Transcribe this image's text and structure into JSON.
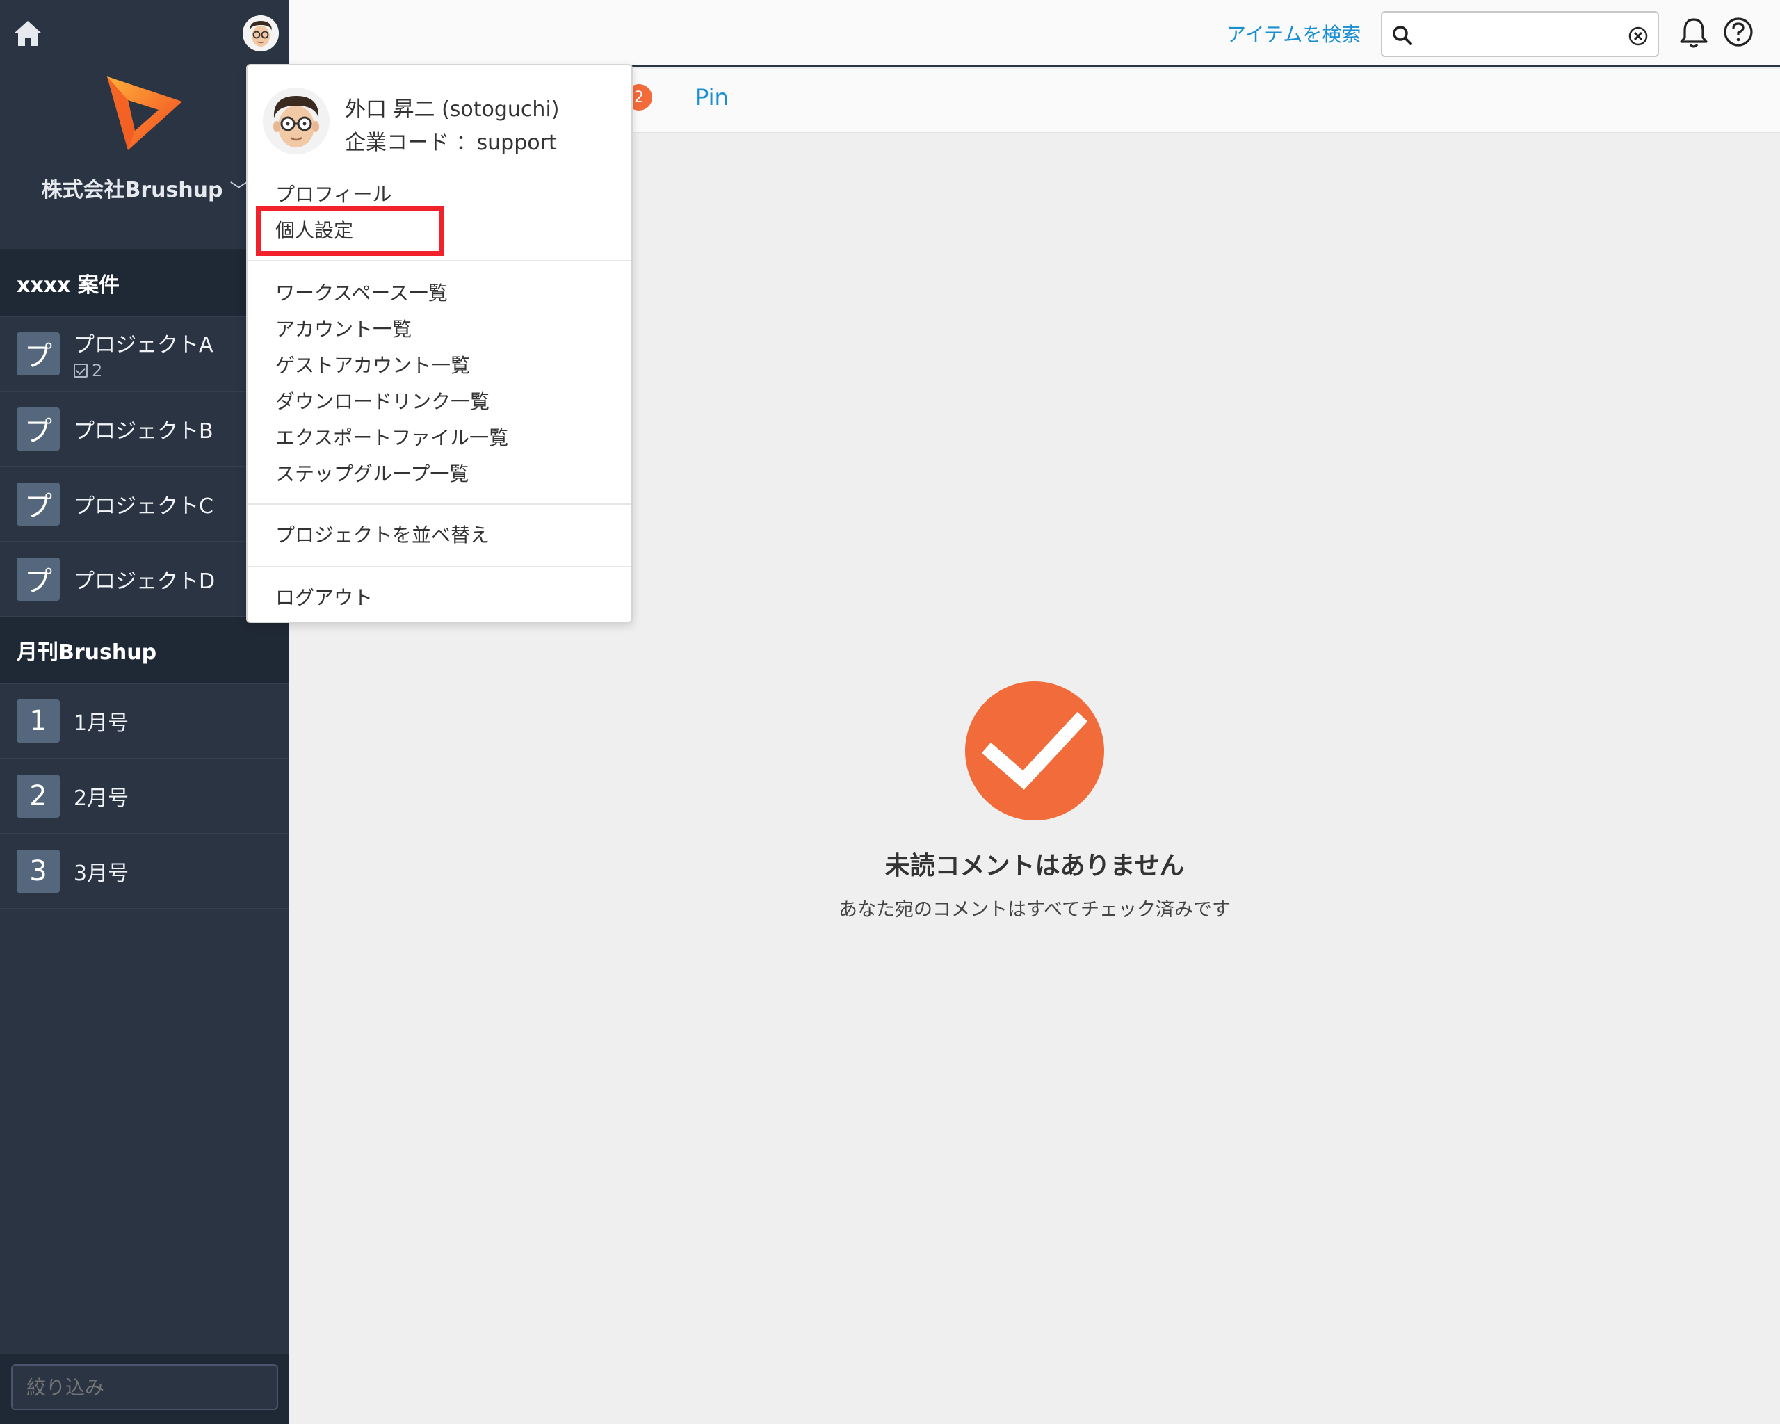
{
  "sidebar": {
    "company_name": "株式会社Brushup",
    "groups": [
      {
        "title": "xxxx 案件",
        "items": [
          {
            "icon_char": "プ",
            "label": "プロジェクトA",
            "sub": "2"
          },
          {
            "icon_char": "プ",
            "label": "プロジェクトB"
          },
          {
            "icon_char": "プ",
            "label": "プロジェクトC"
          },
          {
            "icon_char": "プ",
            "label": "プロジェクトD"
          }
        ]
      },
      {
        "title": "月刊Brushup",
        "items": [
          {
            "icon_char": "1",
            "label": "1月号"
          },
          {
            "icon_char": "2",
            "label": "2月号"
          },
          {
            "icon_char": "3",
            "label": "3月号"
          }
        ]
      }
    ],
    "filter_placeholder": "絞り込み"
  },
  "topbar": {
    "search_label": "アイテムを検索",
    "search_value": ""
  },
  "tabs": {
    "badge_count": "2",
    "pin_label": "Pin"
  },
  "empty_state": {
    "title": "未読コメントはありません",
    "subtitle": "あなた宛のコメントはすべてチェック済みです"
  },
  "user_menu": {
    "user_name": "外口 昇二 (sotoguchi)",
    "company_code": "企業コード ：support",
    "items_section1": [
      "プロフィール",
      "個人設定"
    ],
    "items_section2": [
      "ワークスペース一覧",
      "アカウント一覧",
      "ゲストアカウント一覧",
      "ダウンロードリンク一覧",
      "エクスポートファイル一覧",
      "ステップグループ一覧"
    ],
    "items_section3": [
      "プロジェクトを並べ替え"
    ],
    "items_section4": [
      "ログアウト"
    ],
    "highlighted_item": "個人設定"
  },
  "colors": {
    "sidebar_bg": "#2a3443",
    "accent_link": "#1a8fd0",
    "brand_orange": "#f26b3a",
    "highlight_red": "#f2222c"
  }
}
